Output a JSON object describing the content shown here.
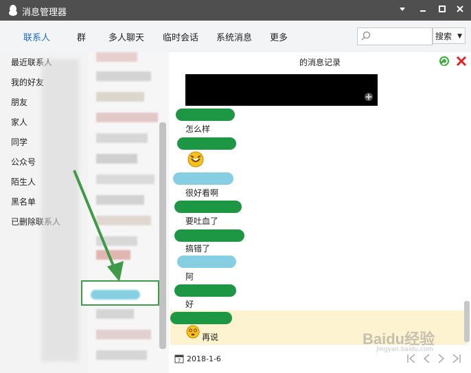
{
  "window": {
    "title": "消息管理器"
  },
  "tabs": [
    {
      "label": "联系人",
      "active": true
    },
    {
      "label": "群"
    },
    {
      "label": "多人聊天"
    },
    {
      "label": "临时会话"
    },
    {
      "label": "系统消息"
    },
    {
      "label": "更多"
    }
  ],
  "search": {
    "placeholder": "",
    "button_label": "搜索"
  },
  "sidebar": {
    "items": [
      {
        "label": "最近联系人"
      },
      {
        "label": "我的好友"
      },
      {
        "label": "朋友"
      },
      {
        "label": "家人"
      },
      {
        "label": "同学"
      },
      {
        "label": "公众号"
      },
      {
        "label": "陌生人"
      },
      {
        "label": "黑名单"
      },
      {
        "label": "已删除联系人"
      }
    ]
  },
  "panel": {
    "title": "的消息记录"
  },
  "messages": [
    {
      "text": "怎么样"
    },
    {
      "text": ""
    },
    {
      "text": "很好看啊"
    },
    {
      "text": "要吐血了"
    },
    {
      "text": "搞错了"
    },
    {
      "text": "阿"
    },
    {
      "text": "好"
    },
    {
      "text": "再说"
    }
  ],
  "footer": {
    "date": "2018-1-6"
  },
  "watermark": {
    "text": "Baidu经验",
    "sub": "jingyan.baidu.com"
  },
  "colors": {
    "accent": "#1a6fd0",
    "name_green": "#1d9744",
    "name_blue": "#86cfe2",
    "highlight": "#fdf3d0",
    "arrow": "#3f9a47"
  }
}
